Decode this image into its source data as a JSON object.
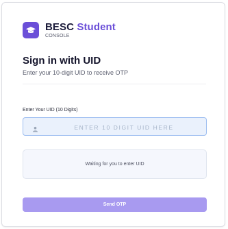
{
  "brand": {
    "title": "BESC",
    "title_accent": "Student",
    "subtitle": "CONSOLE",
    "logo_icon": "graduation-cap-icon"
  },
  "heading": "Sign in with UID",
  "subheading": "Enter your 10-digit UID to receive OTP",
  "uid_field": {
    "label": "Enter Your UID (10 Digits)",
    "placeholder": "ENTER 10 DIGIT UID HERE",
    "value": "",
    "icon": "user-icon"
  },
  "status_message": "Waiting for you to enter UID",
  "send_button_label": "Send OTP",
  "colors": {
    "accent": "#6b4fd8",
    "button": "#a89af0",
    "input_bg": "#eaf1fc",
    "input_border": "#9bbcf0"
  }
}
